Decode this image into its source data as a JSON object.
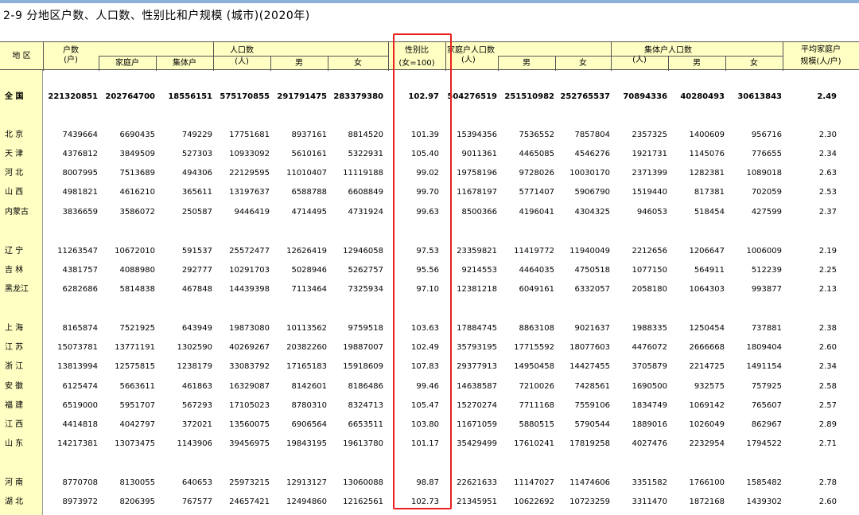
{
  "title": "2-9   分地区户数、人口数、性别比和户规模 (城市)(2020年)",
  "header": {
    "region": "地 区",
    "households": "户数",
    "households_unit": "(户)",
    "family_hh": "家庭户",
    "collective_hh": "集体户",
    "population": "人口数",
    "population_unit": "(人)",
    "male": "男",
    "female": "女",
    "sex_ratio": "性别比",
    "sex_ratio_unit": "(女=100)",
    "family_pop": "家庭户人口数",
    "family_pop_unit": "(人)",
    "family_male": "男",
    "family_female": "女",
    "coll_pop": "集体户人口数",
    "coll_pop_unit": "(人)",
    "coll_male": "男",
    "coll_female": "女",
    "avg_size": "平均家庭户",
    "avg_size_unit": "规模(人/户)"
  },
  "rows": [
    {
      "region": "全 国",
      "v": [
        "221320851",
        "202764700",
        "18556151",
        "575170855",
        "291791475",
        "283379380",
        "102.97",
        "504276519",
        "251510982",
        "252765537",
        "70894336",
        "40280493",
        "30613843",
        "2.49"
      ]
    },
    {
      "region": "北 京",
      "v": [
        "7439664",
        "6690435",
        "749229",
        "17751681",
        "8937161",
        "8814520",
        "101.39",
        "15394356",
        "7536552",
        "7857804",
        "2357325",
        "1400609",
        "956716",
        "2.30"
      ]
    },
    {
      "region": "天 津",
      "v": [
        "4376812",
        "3849509",
        "527303",
        "10933092",
        "5610161",
        "5322931",
        "105.40",
        "9011361",
        "4465085",
        "4546276",
        "1921731",
        "1145076",
        "776655",
        "2.34"
      ]
    },
    {
      "region": "河 北",
      "v": [
        "8007995",
        "7513689",
        "494306",
        "22129595",
        "11010407",
        "11119188",
        "99.02",
        "19758196",
        "9728026",
        "10030170",
        "2371399",
        "1282381",
        "1089018",
        "2.63"
      ]
    },
    {
      "region": "山 西",
      "v": [
        "4981821",
        "4616210",
        "365611",
        "13197637",
        "6588788",
        "6608849",
        "99.70",
        "11678197",
        "5771407",
        "5906790",
        "1519440",
        "817381",
        "702059",
        "2.53"
      ]
    },
    {
      "region": "内蒙古",
      "v": [
        "3836659",
        "3586072",
        "250587",
        "9446419",
        "4714495",
        "4731924",
        "99.63",
        "8500366",
        "4196041",
        "4304325",
        "946053",
        "518454",
        "427599",
        "2.37"
      ]
    },
    {
      "region": "辽 宁",
      "v": [
        "11263547",
        "10672010",
        "591537",
        "25572477",
        "12626419",
        "12946058",
        "97.53",
        "23359821",
        "11419772",
        "11940049",
        "2212656",
        "1206647",
        "1006009",
        "2.19"
      ]
    },
    {
      "region": "吉 林",
      "v": [
        "4381757",
        "4088980",
        "292777",
        "10291703",
        "5028946",
        "5262757",
        "95.56",
        "9214553",
        "4464035",
        "4750518",
        "1077150",
        "564911",
        "512239",
        "2.25"
      ]
    },
    {
      "region": "黑龙江",
      "v": [
        "6282686",
        "5814838",
        "467848",
        "14439398",
        "7113464",
        "7325934",
        "97.10",
        "12381218",
        "6049161",
        "6332057",
        "2058180",
        "1064303",
        "993877",
        "2.13"
      ]
    },
    {
      "region": "上 海",
      "v": [
        "8165874",
        "7521925",
        "643949",
        "19873080",
        "10113562",
        "9759518",
        "103.63",
        "17884745",
        "8863108",
        "9021637",
        "1988335",
        "1250454",
        "737881",
        "2.38"
      ]
    },
    {
      "region": "江 苏",
      "v": [
        "15073781",
        "13771191",
        "1302590",
        "40269267",
        "20382260",
        "19887007",
        "102.49",
        "35793195",
        "17715592",
        "18077603",
        "4476072",
        "2666668",
        "1809404",
        "2.60"
      ]
    },
    {
      "region": "浙 江",
      "v": [
        "13813994",
        "12575815",
        "1238179",
        "33083792",
        "17165183",
        "15918609",
        "107.83",
        "29377913",
        "14950458",
        "14427455",
        "3705879",
        "2214725",
        "1491154",
        "2.34"
      ]
    },
    {
      "region": "安 徽",
      "v": [
        "6125474",
        "5663611",
        "461863",
        "16329087",
        "8142601",
        "8186486",
        "99.46",
        "14638587",
        "7210026",
        "7428561",
        "1690500",
        "932575",
        "757925",
        "2.58"
      ]
    },
    {
      "region": "福 建",
      "v": [
        "6519000",
        "5951707",
        "567293",
        "17105023",
        "8780310",
        "8324713",
        "105.47",
        "15270274",
        "7711168",
        "7559106",
        "1834749",
        "1069142",
        "765607",
        "2.57"
      ]
    },
    {
      "region": "江 西",
      "v": [
        "4414818",
        "4042797",
        "372021",
        "13560075",
        "6906564",
        "6653511",
        "103.80",
        "11671059",
        "5880515",
        "5790544",
        "1889016",
        "1026049",
        "862967",
        "2.89"
      ]
    },
    {
      "region": "山 东",
      "v": [
        "14217381",
        "13073475",
        "1143906",
        "39456975",
        "19843195",
        "19613780",
        "101.17",
        "35429499",
        "17610241",
        "17819258",
        "4027476",
        "2232954",
        "1794522",
        "2.71"
      ]
    },
    {
      "region": "河 南",
      "v": [
        "8770708",
        "8130055",
        "640653",
        "25973215",
        "12913127",
        "13060088",
        "98.87",
        "22621633",
        "11147027",
        "11474606",
        "3351582",
        "1766100",
        "1585482",
        "2.78"
      ]
    },
    {
      "region": "湖 北",
      "v": [
        "8973972",
        "8206395",
        "767577",
        "24657421",
        "12494860",
        "12162561",
        "102.73",
        "21345951",
        "10622692",
        "10723259",
        "3311470",
        "1872168",
        "1439302",
        "2.60"
      ]
    }
  ],
  "colors": {
    "header_bg": "#ffffc4",
    "highlight": "#e8201e"
  }
}
